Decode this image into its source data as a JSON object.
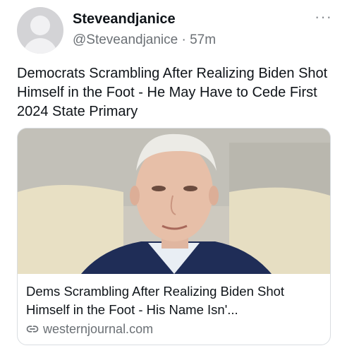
{
  "post": {
    "display_name": "Steveandjanice",
    "handle": "@Steveandjanice",
    "separator": "·",
    "time": "57m",
    "more_icon": "more-horizontal-icon",
    "text": "Democrats Scrambling After Realizing Biden Shot Himself in the Foot - He May Have to Cede First 2024 State Primary"
  },
  "card": {
    "title": "Dems Scrambling After Realizing Biden Shot Himself in the Foot - His Name Isn'...",
    "domain": "westernjournal.com",
    "link_icon": "link-icon",
    "image": "photo-of-elderly-man-in-suit"
  },
  "colors": {
    "text": "#0f1419",
    "secondary": "#6b7075",
    "border": "#d9dde1"
  }
}
